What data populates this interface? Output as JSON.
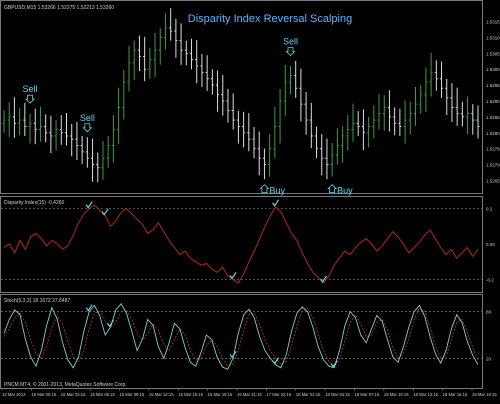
{
  "symbol_header": "GBPUSD,M15 1.53266 1.52275 1.52213 1.53260",
  "title": "Disparity Index Reversal Scalping",
  "footer": "PNCM MT4, © 2001-2013, MetaQuotes Software Corp.",
  "colors": {
    "background": "#000000",
    "bull_bar": "#3f9b3f",
    "bear_bar": "#dddddd",
    "title": "#5ab4ff",
    "signal": "#63d4f0",
    "disparity_line": "#b3261e",
    "stoch_main": "#7fd1c8",
    "stoch_signal": "#c0392b",
    "panel_border": "#7a7a7a",
    "level_line": "#9a9a9a",
    "axis_text": "#cfcfcf"
  },
  "chart_data": [
    {
      "type": "candlestick",
      "panel": "price",
      "title": "Disparity Index Reversal Scalping",
      "y_ticks": [
        "1.5315",
        "1.5310",
        "1.5305",
        "1.5300",
        "1.5295",
        "1.5290",
        "1.5285",
        "1.5280",
        "1.5275",
        "1.5270",
        "1.5265"
      ],
      "ylim": [
        1.5262,
        1.5318
      ],
      "close": [
        1.5284,
        1.5285,
        1.5283,
        1.5284,
        1.5282,
        1.5283,
        1.5281,
        1.5282,
        1.528,
        1.5279,
        1.5281,
        1.528,
        1.5279,
        1.5278,
        1.5276,
        1.5274,
        1.5272,
        1.527,
        1.5269,
        1.5272,
        1.5276,
        1.5281,
        1.5288,
        1.5296,
        1.5302,
        1.5306,
        1.5304,
        1.53,
        1.5303,
        1.5306,
        1.531,
        1.5313,
        1.5312,
        1.5309,
        1.5306,
        1.5305,
        1.5303,
        1.5301,
        1.5299,
        1.5297,
        1.5295,
        1.5292,
        1.529,
        1.5287,
        1.5284,
        1.5282,
        1.528,
        1.5278,
        1.5275,
        1.5272,
        1.527,
        1.5275,
        1.5282,
        1.529,
        1.5296,
        1.5298,
        1.5294,
        1.5289,
        1.5284,
        1.5279,
        1.5275,
        1.5272,
        1.527,
        1.5273,
        1.5276,
        1.5279,
        1.5281,
        1.5283,
        1.5282,
        1.528,
        1.5282,
        1.5284,
        1.5286,
        1.5288,
        1.5285,
        1.5283,
        1.5282,
        1.5284,
        1.5286,
        1.5289,
        1.5292,
        1.5296,
        1.5299,
        1.5297,
        1.5294,
        1.5291,
        1.5288,
        1.5286,
        1.5285,
        1.5286,
        1.5284,
        1.5282
      ],
      "annotations": [
        {
          "text": "Sell",
          "bar": 16,
          "kind": "sell"
        },
        {
          "text": "Sell",
          "bar": 5,
          "kind": "sell"
        },
        {
          "text": "Sell",
          "bar": 55,
          "kind": "sell"
        },
        {
          "text": "Buy",
          "bar": 50,
          "kind": "buy"
        },
        {
          "text": "Buy",
          "bar": 63,
          "kind": "buy"
        }
      ]
    },
    {
      "type": "line",
      "panel": "disparity",
      "label": "Disparity Index(15) -0.4260",
      "y_ticks": [
        "0.2",
        "0.00",
        "-0.2"
      ],
      "ylim": [
        -0.26,
        0.26
      ],
      "levels": [
        0.2,
        -0.2
      ],
      "values": [
        -0.02,
        0.0,
        -0.05,
        0.02,
        -0.03,
        0.04,
        0.06,
        0.03,
        -0.01,
        0.02,
        0.0,
        -0.03,
        -0.01,
        0.05,
        0.12,
        0.17,
        0.2,
        0.22,
        0.19,
        0.16,
        0.1,
        0.13,
        0.18,
        0.2,
        0.17,
        0.14,
        0.11,
        0.06,
        0.08,
        0.12,
        0.07,
        0.02,
        -0.02,
        -0.06,
        -0.04,
        -0.08,
        -0.1,
        -0.12,
        -0.11,
        -0.14,
        -0.16,
        -0.13,
        -0.18,
        -0.2,
        -0.22,
        -0.17,
        -0.1,
        -0.04,
        0.03,
        0.1,
        0.16,
        0.21,
        0.18,
        0.12,
        0.06,
        0.02,
        -0.05,
        -0.11,
        -0.16,
        -0.19,
        -0.22,
        -0.18,
        -0.12,
        -0.08,
        -0.04,
        -0.06,
        -0.02,
        0.01,
        0.03,
        0.0,
        -0.04,
        -0.01,
        0.03,
        0.07,
        0.04,
        0.0,
        -0.05,
        -0.02,
        0.01,
        0.05,
        0.08,
        0.03,
        -0.02,
        -0.06,
        -0.03,
        -0.08,
        -0.05,
        -0.02,
        -0.07,
        -0.03
      ],
      "checks": [
        16,
        19,
        43,
        51,
        60
      ]
    },
    {
      "type": "line",
      "panel": "stochastic",
      "label": "Stoch(5,3,3) 18.1672 27.8487",
      "y_ticks": [
        "80",
        "20"
      ],
      "ylim": [
        0,
        100
      ],
      "levels": [
        80,
        20
      ],
      "series": [
        {
          "name": "",
          "values": [
            52,
            70,
            82,
            76,
            45,
            22,
            10,
            30,
            62,
            85,
            70,
            40,
            18,
            8,
            22,
            55,
            80,
            88,
            74,
            50,
            60,
            82,
            90,
            78,
            55,
            30,
            45,
            70,
            62,
            35,
            20,
            40,
            65,
            58,
            34,
            15,
            10,
            28,
            50,
            44,
            22,
            9,
            6,
            20,
            52,
            76,
            83,
            72,
            48,
            30,
            20,
            12,
            8,
            25,
            55,
            78,
            86,
            80,
            60,
            35,
            18,
            10,
            8,
            30,
            62,
            80,
            72,
            50,
            40,
            58,
            75,
            68,
            44,
            22,
            15,
            35,
            60,
            80,
            88,
            74,
            48,
            26,
            14,
            30,
            58,
            76,
            66,
            42,
            24,
            12
          ]
        },
        {
          "name": "",
          "values": [
            48,
            58,
            72,
            78,
            66,
            44,
            26,
            20,
            36,
            60,
            74,
            64,
            42,
            22,
            16,
            30,
            58,
            78,
            80,
            68,
            60,
            66,
            80,
            82,
            70,
            52,
            44,
            52,
            64,
            56,
            38,
            30,
            44,
            58,
            50,
            30,
            18,
            20,
            36,
            44,
            36,
            20,
            10,
            12,
            30,
            56,
            76,
            78,
            64,
            44,
            30,
            20,
            12,
            16,
            36,
            62,
            80,
            84,
            72,
            50,
            30,
            16,
            10,
            18,
            42,
            66,
            76,
            64,
            48,
            50,
            66,
            70,
            56,
            34,
            20,
            26,
            46,
            70,
            84,
            80,
            60,
            36,
            20,
            22,
            44,
            66,
            70,
            54,
            34,
            18
          ]
        }
      ],
      "checks": [
        16,
        20,
        43,
        51,
        62
      ]
    }
  ],
  "x_ticks": [
    "14 Mar 2013",
    "15 Mar 00:15",
    "15 Mar 03:15",
    "15 Mar 06:15",
    "15 Mar 09:15",
    "15 Mar 12:15",
    "15 Mar 15:15",
    "15 Mar 18:15",
    "15 Mar 21:15",
    "17 Mar 22:15",
    "18 Mar 01:15",
    "18 Mar 04:15",
    "18 Mar 07:15",
    "18 Mar 10:15",
    "18 Mar 13:15",
    "18 Mar 16:15",
    "18 Mar 19:15"
  ]
}
